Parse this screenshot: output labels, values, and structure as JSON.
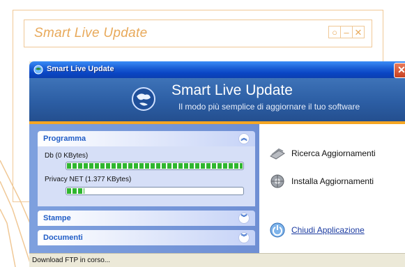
{
  "background_frame": {
    "title": "Smart Live Update",
    "buttons": [
      "○",
      "–",
      "✕"
    ],
    "color": "#f0c896"
  },
  "window": {
    "title": "Smart Live Update",
    "close_glyph": "✕",
    "header": {
      "title": "Smart Live Update",
      "subtitle": "Il modo più semplice di aggiornare il tuo software"
    },
    "groups": [
      {
        "label": "Programma",
        "expanded": true,
        "items": [
          {
            "label": "Db (0 KBytes)",
            "progress": 1.0
          },
          {
            "label": "Privacy NET (1.377 KBytes)",
            "progress": 0.1
          }
        ]
      },
      {
        "label": "Stampe",
        "expanded": false
      },
      {
        "label": "Documenti",
        "expanded": false
      }
    ],
    "actions": [
      {
        "label": "Ricerca Aggiornamenti",
        "icon": "scanner-icon"
      },
      {
        "label": "Installa Aggiornamenti",
        "icon": "globe-gear-icon"
      },
      {
        "label": "Chiudi Applicazione",
        "icon": "power-icon"
      }
    ],
    "status": "Download FTP in corso...",
    "colors": {
      "titlebar": "#1b5fd6",
      "header": "#2c5ea4",
      "accent": "#f5a623",
      "progress": "#2fb62f"
    }
  }
}
